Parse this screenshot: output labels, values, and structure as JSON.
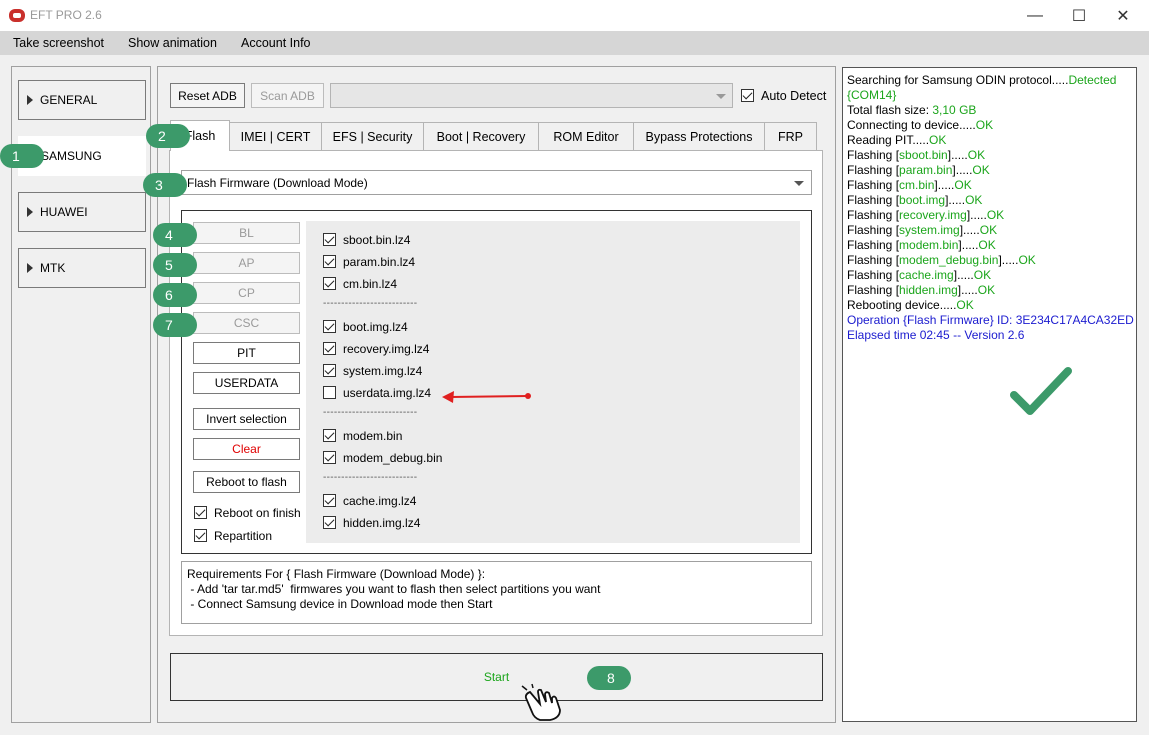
{
  "window": {
    "title": "EFT PRO 2.6",
    "minimize": "—",
    "maximize": "☐",
    "close": "✕"
  },
  "menu": [
    "Take screenshot",
    "Show animation",
    "Account Info"
  ],
  "sidebar": [
    {
      "label": "GENERAL"
    },
    {
      "label": "SAMSUNG"
    },
    {
      "label": "HUAWEI"
    },
    {
      "label": "MTK"
    }
  ],
  "toolbar": {
    "reset_adb": "Reset ADB",
    "scan_adb": "Scan ADB",
    "port_value": "",
    "auto_detect": "Auto Detect"
  },
  "tabs": [
    "Flash",
    "IMEI | CERT",
    "EFS | Security",
    "Boot | Recovery",
    "ROM Editor",
    "Bypass Protections",
    "FRP"
  ],
  "mode_select": "Flash Firmware (Download Mode)",
  "file_buttons": [
    "BL",
    "AP",
    "CP",
    "CSC",
    "PIT",
    "USERDATA"
  ],
  "actions": {
    "invert": "Invert selection",
    "clear": "Clear",
    "reboot_flash": "Reboot to flash"
  },
  "options": {
    "reboot_finish": "Reboot on finish",
    "repartition": "Repartition"
  },
  "partitions": [
    {
      "name": "sboot.bin.lz4",
      "checked": true
    },
    {
      "name": "param.bin.lz4",
      "checked": true
    },
    {
      "name": "cm.bin.lz4",
      "checked": true
    },
    {
      "name": "boot.img.lz4",
      "checked": true
    },
    {
      "name": "recovery.img.lz4",
      "checked": true
    },
    {
      "name": "system.img.lz4",
      "checked": true
    },
    {
      "name": "userdata.img.lz4",
      "checked": false
    },
    {
      "name": "modem.bin",
      "checked": true
    },
    {
      "name": "modem_debug.bin",
      "checked": true
    },
    {
      "name": "cache.img.lz4",
      "checked": true
    },
    {
      "name": "hidden.img.lz4",
      "checked": true
    }
  ],
  "separator": "--------------------------",
  "requirements": {
    "title": "Requirements For { Flash Firmware (Download Mode) }:",
    "line1": " - Add 'tar tar.md5'  firmwares you want to flash then select partitions you want",
    "line2": " - Connect Samsung device in Download mode then Start"
  },
  "start": "Start",
  "markers": [
    "1",
    "2",
    "3",
    "4",
    "5",
    "6",
    "7",
    "8"
  ],
  "log": [
    {
      "text": "Searching for Samsung ODIN protocol.....",
      "status": "Detected"
    },
    {
      "text": "",
      "status": "{COM14}"
    },
    {
      "text": "Total flash size: ",
      "status": "3,10 GB"
    },
    {
      "text": "Connecting to device.....",
      "status": "OK"
    },
    {
      "text": "Reading PIT.....",
      "status": "OK"
    },
    {
      "pre": "Flashing [",
      "file": "sboot.bin",
      "post": "].....",
      "status": "OK"
    },
    {
      "pre": "Flashing [",
      "file": "param.bin",
      "post": "].....",
      "status": "OK"
    },
    {
      "pre": "Flashing [",
      "file": "cm.bin",
      "post": "].....",
      "status": "OK"
    },
    {
      "pre": "Flashing [",
      "file": "boot.img",
      "post": "].....",
      "status": "OK"
    },
    {
      "pre": "Flashing [",
      "file": "recovery.img",
      "post": "].....",
      "status": "OK"
    },
    {
      "pre": "Flashing [",
      "file": "system.img",
      "post": "].....",
      "status": "OK"
    },
    {
      "pre": "Flashing [",
      "file": "modem.bin",
      "post": "].....",
      "status": "OK"
    },
    {
      "pre": "Flashing [",
      "file": "modem_debug.bin",
      "post": "].....",
      "status": "OK"
    },
    {
      "pre": "Flashing [",
      "file": "cache.img",
      "post": "].....",
      "status": "OK"
    },
    {
      "pre": "Flashing [",
      "file": "hidden.img",
      "post": "].....",
      "status": "OK"
    },
    {
      "text": "Rebooting device.....",
      "status": "OK"
    },
    {
      "blue": "Operation {Flash Firmware} ID: 3E234C17A4CA32ED"
    },
    {
      "blue": "Elapsed time 02:45 -- Version 2.6"
    }
  ],
  "colors": {
    "ok": "#1ba51b",
    "info": "#1b1bcf",
    "marker": "#3c9a6a",
    "clear": "#e00000",
    "arrow": "#e02020"
  }
}
